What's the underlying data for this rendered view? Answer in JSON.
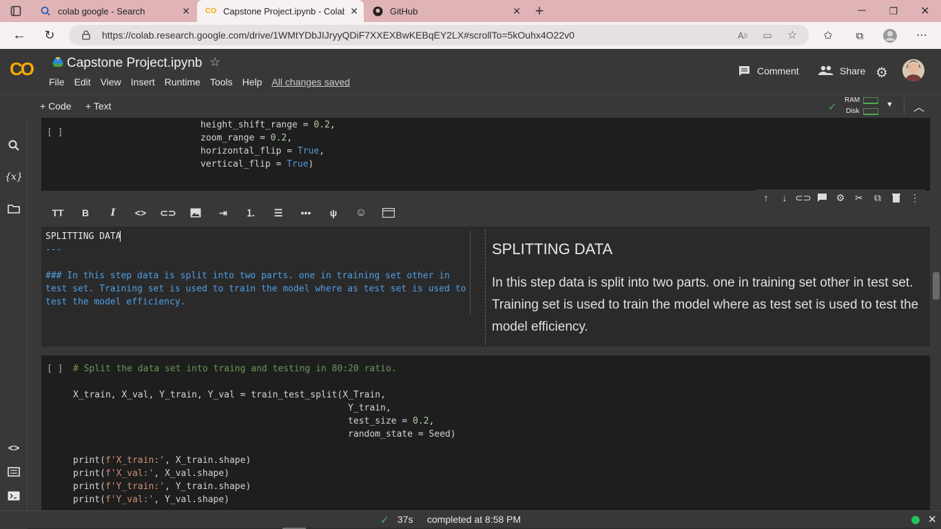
{
  "browser": {
    "tabs": [
      {
        "title": "colab google - Search",
        "icon": "search-icon"
      },
      {
        "title": "Capstone Project.ipynb - Colabor",
        "icon": "colab-logo-icon"
      },
      {
        "title": "GitHub",
        "icon": "github-icon"
      }
    ],
    "url": "https://colab.research.google.com/drive/1WMtYDbJIJryyQDiF7XXEXBwKEBqEY2LX#scrollTo=5kOuhx4O22v0"
  },
  "colab": {
    "logo": "CO",
    "notebook_title": "Capstone Project.ipynb",
    "menu": [
      "File",
      "Edit",
      "View",
      "Insert",
      "Runtime",
      "Tools",
      "Help"
    ],
    "save_status": "All changes saved",
    "comment_label": "Comment",
    "share_label": "Share",
    "add_code": "+ Code",
    "add_text": "+ Text",
    "ram_label": "RAM",
    "disk_label": "Disk",
    "accent": "#f9ab00"
  },
  "cell1": {
    "run_label": "[ ]",
    "lines": [
      [
        {
          "t": "height_shift_range = ",
          "c": ""
        },
        {
          "t": "0.2",
          "c": "num"
        },
        {
          "t": ",",
          "c": ""
        }
      ],
      [
        {
          "t": "zoom_range = ",
          "c": ""
        },
        {
          "t": "0.2",
          "c": "num"
        },
        {
          "t": ",",
          "c": ""
        }
      ],
      [
        {
          "t": "horizontal_flip = ",
          "c": ""
        },
        {
          "t": "True",
          "c": "kw"
        },
        {
          "t": ",",
          "c": ""
        }
      ],
      [
        {
          "t": "vertical_flip = ",
          "c": ""
        },
        {
          "t": "True",
          "c": "kw"
        },
        {
          "t": ")",
          "c": ""
        }
      ]
    ]
  },
  "textcell": {
    "editor_lines": [
      "SPLITTING DATA",
      "---",
      "",
      "### In this step data is split into two parts. one in training set other in",
      "test set. Training set is used to train the model where as test set is used to",
      "test the model efficiency."
    ],
    "preview_heading": "SPLITTING DATA",
    "preview_body": "In this step data is split into two parts. one in training set other in test set. Training set is used to train the model where as test set is used to test the model efficiency."
  },
  "cell2": {
    "run_label": "[ ]",
    "lines": [
      [
        {
          "t": "# Split the data set into traing and testing in 80:20 ratio.",
          "c": "cmt"
        }
      ],
      [],
      [
        {
          "t": "X_train, X_val, Y_train, Y_val = train_test_split(X_Train,",
          "c": ""
        }
      ],
      [
        {
          "t": "                                                   Y_train,",
          "c": ""
        }
      ],
      [
        {
          "t": "                                                   test_size = ",
          "c": ""
        },
        {
          "t": "0.2",
          "c": "num"
        },
        {
          "t": ",",
          "c": ""
        }
      ],
      [
        {
          "t": "                                                   random_state = Seed)",
          "c": ""
        }
      ],
      [],
      [
        {
          "t": "print(",
          "c": ""
        },
        {
          "t": "f'X_train:'",
          "c": "str"
        },
        {
          "t": ", X_train.shape)",
          "c": ""
        }
      ],
      [
        {
          "t": "print(",
          "c": ""
        },
        {
          "t": "f'X_val:'",
          "c": "str"
        },
        {
          "t": ", X_val.shape)",
          "c": ""
        }
      ],
      [
        {
          "t": "print(",
          "c": ""
        },
        {
          "t": "f'Y_train:'",
          "c": "str"
        },
        {
          "t": ", Y_train.shape)",
          "c": ""
        }
      ],
      [
        {
          "t": "print(",
          "c": ""
        },
        {
          "t": "f'Y_val:'",
          "c": "str"
        },
        {
          "t": ", Y_val.shape)",
          "c": ""
        }
      ]
    ]
  },
  "statusbar": {
    "duration": "37s",
    "completed": "completed at 8:58 PM"
  }
}
